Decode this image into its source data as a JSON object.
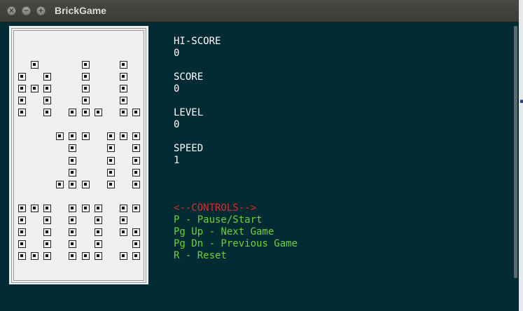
{
  "window": {
    "title": "BrickGame"
  },
  "stats": {
    "hiscore_label": "HI-SCORE",
    "hiscore_value": "0",
    "score_label": "SCORE",
    "score_value": "0",
    "level_label": "LEVEL",
    "level_value": "0",
    "speed_label": "SPEED",
    "speed_value": "1"
  },
  "controls": {
    "header": "<--CONTROLS-->",
    "items": [
      "P - Pause/Start",
      "Pg Up - Next Game",
      "Pg Dn - Previous Game",
      "R - Reset"
    ]
  },
  "colors": {
    "background": "#032b33",
    "text": "#ffffff",
    "controls_header": "#e2282b",
    "controls_items": "#6bd23a"
  },
  "board_cells": [
    [
      1,
      7
    ],
    [
      5,
      7
    ],
    [
      8,
      7
    ],
    [
      0,
      8
    ],
    [
      2,
      8
    ],
    [
      5,
      8
    ],
    [
      8,
      8
    ],
    [
      0,
      9
    ],
    [
      1,
      9
    ],
    [
      2,
      9
    ],
    [
      5,
      9
    ],
    [
      8,
      9
    ],
    [
      0,
      10
    ],
    [
      2,
      10
    ],
    [
      5,
      10
    ],
    [
      8,
      10
    ],
    [
      0,
      11
    ],
    [
      2,
      11
    ],
    [
      4,
      11
    ],
    [
      5,
      11
    ],
    [
      6,
      11
    ],
    [
      8,
      11
    ],
    [
      9,
      11
    ],
    [
      3,
      13
    ],
    [
      4,
      13
    ],
    [
      5,
      13
    ],
    [
      7,
      13
    ],
    [
      8,
      13
    ],
    [
      9,
      13
    ],
    [
      4,
      14
    ],
    [
      7,
      14
    ],
    [
      9,
      14
    ],
    [
      4,
      15
    ],
    [
      7,
      15
    ],
    [
      9,
      15
    ],
    [
      4,
      16
    ],
    [
      7,
      16
    ],
    [
      9,
      16
    ],
    [
      3,
      17
    ],
    [
      4,
      17
    ],
    [
      5,
      17
    ],
    [
      7,
      17
    ],
    [
      9,
      17
    ],
    [
      0,
      19
    ],
    [
      1,
      19
    ],
    [
      2,
      19
    ],
    [
      4,
      19
    ],
    [
      5,
      19
    ],
    [
      6,
      19
    ],
    [
      8,
      19
    ],
    [
      9,
      19
    ],
    [
      0,
      20
    ],
    [
      2,
      20
    ],
    [
      4,
      20
    ],
    [
      6,
      20
    ],
    [
      8,
      20
    ],
    [
      0,
      21
    ],
    [
      2,
      21
    ],
    [
      4,
      21
    ],
    [
      6,
      21
    ],
    [
      8,
      21
    ],
    [
      9,
      21
    ],
    [
      0,
      22
    ],
    [
      2,
      22
    ],
    [
      4,
      22
    ],
    [
      6,
      22
    ],
    [
      9,
      22
    ],
    [
      0,
      23
    ],
    [
      1,
      23
    ],
    [
      2,
      23
    ],
    [
      4,
      23
    ],
    [
      5,
      23
    ],
    [
      6,
      23
    ],
    [
      8,
      23
    ],
    [
      9,
      23
    ]
  ]
}
